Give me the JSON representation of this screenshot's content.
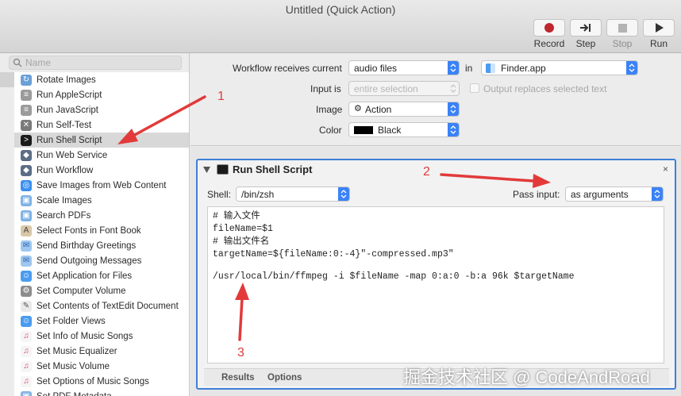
{
  "window": {
    "title": "Untitled (Quick Action)"
  },
  "toolbar": {
    "record_label": "Record",
    "step_label": "Step",
    "stop_label": "Stop",
    "run_label": "Run"
  },
  "sidebar": {
    "search_placeholder": "Name",
    "items": [
      {
        "label": "Rotate Images",
        "icon": "image-rotate-icon"
      },
      {
        "label": "Run AppleScript",
        "icon": "script-icon"
      },
      {
        "label": "Run JavaScript",
        "icon": "script-icon"
      },
      {
        "label": "Run Self-Test",
        "icon": "tools-icon"
      },
      {
        "label": "Run Shell Script",
        "icon": "terminal-icon",
        "selected": true
      },
      {
        "label": "Run Web Service",
        "icon": "automator-icon"
      },
      {
        "label": "Run Workflow",
        "icon": "automator-icon"
      },
      {
        "label": "Save Images from Web Content",
        "icon": "safari-icon"
      },
      {
        "label": "Scale Images",
        "icon": "preview-icon"
      },
      {
        "label": "Search PDFs",
        "icon": "preview-icon"
      },
      {
        "label": "Select Fonts in Font Book",
        "icon": "font-book-icon"
      },
      {
        "label": "Send Birthday Greetings",
        "icon": "mail-icon"
      },
      {
        "label": "Send Outgoing Messages",
        "icon": "mail-icon"
      },
      {
        "label": "Set Application for Files",
        "icon": "finder-icon"
      },
      {
        "label": "Set Computer Volume",
        "icon": "system-prefs-icon"
      },
      {
        "label": "Set Contents of TextEdit Document",
        "icon": "textedit-icon"
      },
      {
        "label": "Set Folder Views",
        "icon": "finder-icon"
      },
      {
        "label": "Set Info of Music Songs",
        "icon": "music-icon"
      },
      {
        "label": "Set Music Equalizer",
        "icon": "music-icon"
      },
      {
        "label": "Set Music Volume",
        "icon": "music-icon"
      },
      {
        "label": "Set Options of Music Songs",
        "icon": "music-icon"
      },
      {
        "label": "Set PDF Metadata",
        "icon": "preview-icon"
      }
    ]
  },
  "workflow": {
    "receives_label": "Workflow receives current",
    "receives_value": "audio files",
    "in_label": "in",
    "app_value": "Finder.app",
    "input_is_label": "Input is",
    "input_is_value": "entire selection",
    "output_replaces_label": "Output replaces selected text",
    "image_label": "Image",
    "image_value": "Action",
    "color_label": "Color",
    "color_value": "Black",
    "color_swatch": "#000000"
  },
  "action": {
    "title": "Run Shell Script",
    "close_glyph": "×",
    "shell_label": "Shell:",
    "shell_value": "/bin/zsh",
    "pass_input_label": "Pass input:",
    "pass_input_value": "as arguments",
    "script_lines": [
      "# 输入文件",
      "fileName=$1",
      "# 输出文件名",
      "targetName=${fileName:0:-4}\"-compressed.mp3\"",
      "",
      "/usr/local/bin/ffmpeg -i $fileName -map 0:a:0 -b:a 96k $targetName"
    ],
    "tabs": [
      "Results",
      "Options"
    ]
  },
  "annotations": {
    "n1": "1",
    "n2": "2",
    "n3": "3",
    "arrow_color": "#e23a3a"
  },
  "watermark": "掘金技术社区 @ CodeAndRoad",
  "colors": {
    "accent": "#3f7fd9",
    "stepper": "#3b82f6",
    "record": "#c0262d"
  }
}
